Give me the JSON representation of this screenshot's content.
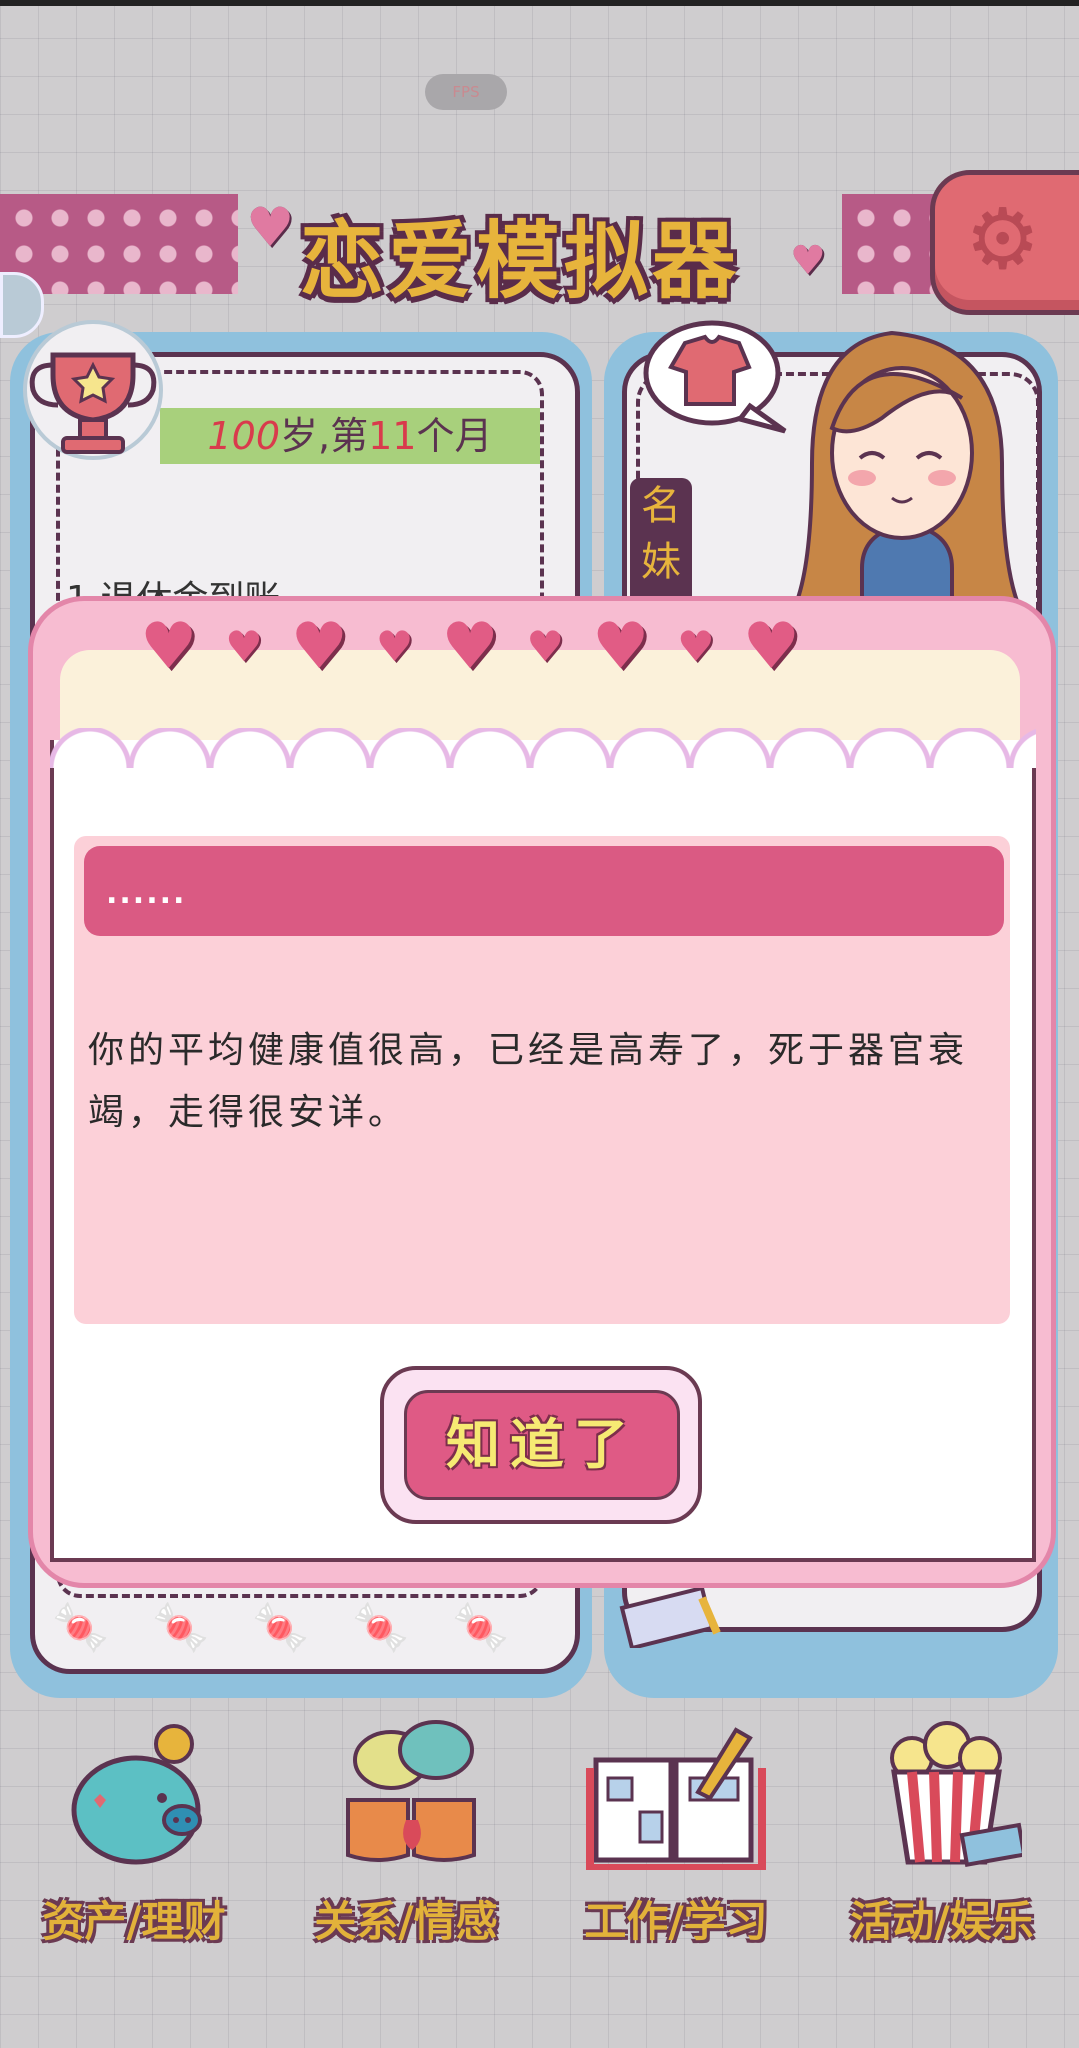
{
  "status": {
    "fps_label": "FPS"
  },
  "header": {
    "title": "恋爱模拟器",
    "settings_icon": "gear-icon"
  },
  "left_panel": {
    "age_number": "100",
    "age_unit": "岁,第",
    "month_number": "11",
    "month_unit": "个月",
    "event_text": "1.退休金到账"
  },
  "right_panel": {
    "name_label": "名妹"
  },
  "dialog": {
    "header_text": "......",
    "message": "你的平均健康值很高，已经是高寿了，死于器官衰竭，走得很安详。",
    "confirm_label": "知道了"
  },
  "nav": [
    {
      "label": "资产/理财",
      "icon": "piggy-bank-icon"
    },
    {
      "label": "关系/情感",
      "icon": "coffee-cups-icon"
    },
    {
      "label": "工作/学习",
      "icon": "notebook-icon"
    },
    {
      "label": "活动/娱乐",
      "icon": "popcorn-icon"
    }
  ],
  "colors": {
    "accent_pink": "#da5a83",
    "title_gold": "#e7b43c",
    "outline": "#5b3350"
  }
}
